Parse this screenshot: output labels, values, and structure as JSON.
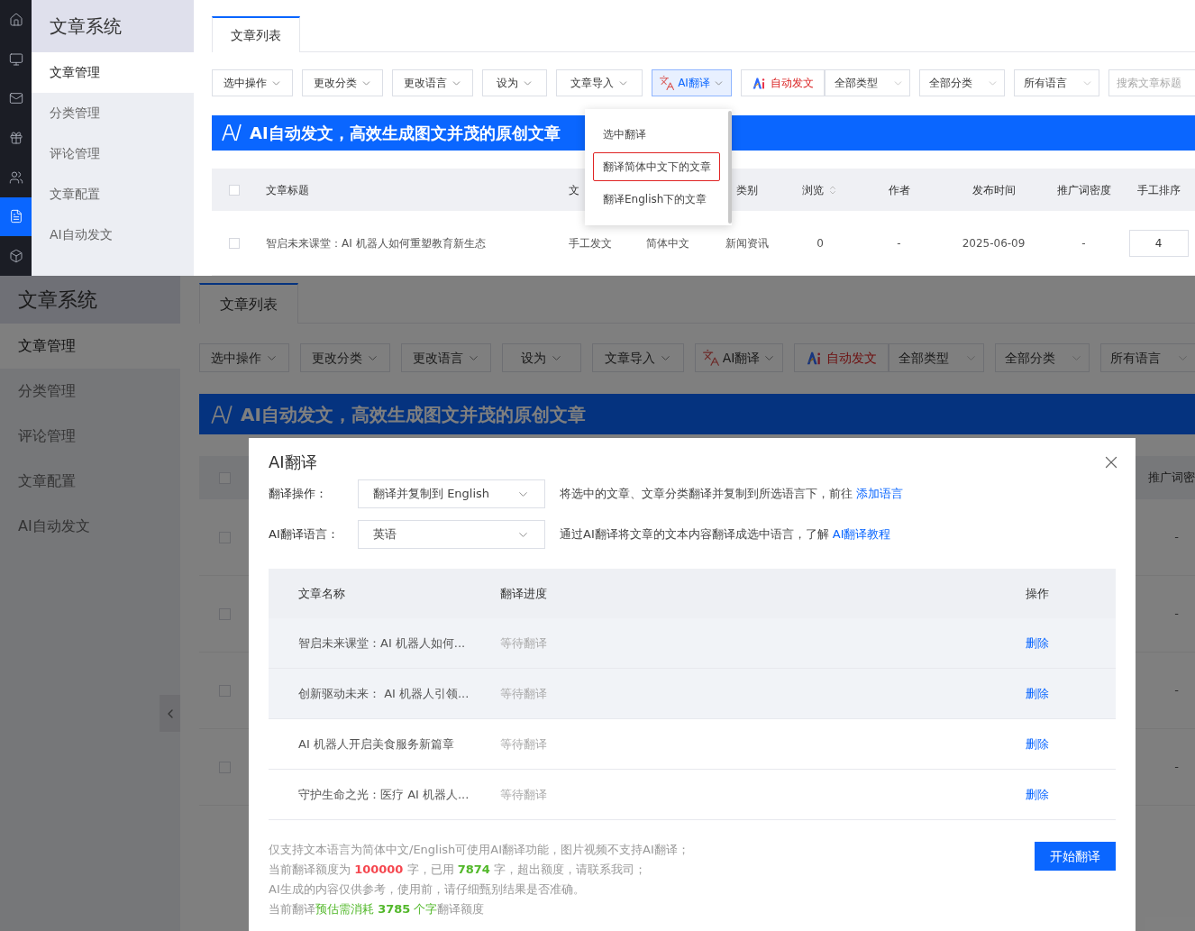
{
  "top": {
    "nav_icons": [
      {
        "selected": false
      },
      {
        "selected": false
      },
      {
        "selected": false
      },
      {
        "selected": false
      },
      {
        "selected": false
      },
      {
        "selected": true
      },
      {
        "selected": false
      }
    ],
    "sidebar": {
      "title": "文章系统",
      "items": [
        {
          "label": "文章管理",
          "selected": true
        },
        {
          "label": "分类管理",
          "selected": false
        },
        {
          "label": "评论管理",
          "selected": false
        },
        {
          "label": "文章配置",
          "selected": false
        },
        {
          "label": "AI自动发文",
          "selected": false
        }
      ]
    },
    "tabs": [
      {
        "label": "文章列表",
        "selected": true
      }
    ],
    "toolbar": [
      {
        "kind": "menu",
        "label": "选中操作"
      },
      {
        "kind": "menu",
        "label": "更改分类"
      },
      {
        "kind": "menu",
        "label": "更改语言"
      },
      {
        "kind": "menu",
        "label": "设为"
      },
      {
        "kind": "menu",
        "label": "文章导入"
      },
      {
        "kind": "translate",
        "label": "AI翻译",
        "expanded": true
      },
      {
        "kind": "autopost",
        "label": "自动发文"
      },
      {
        "kind": "select",
        "label": "全部类型"
      },
      {
        "kind": "select",
        "label": "全部分类"
      },
      {
        "kind": "select",
        "label": "所有语言"
      },
      {
        "kind": "search",
        "placeholder": "搜索文章标题"
      }
    ],
    "banner": "AI自动发文，高效生成图文并茂的原创文章",
    "table": {
      "header_checked": false,
      "columns": [
        {
          "label": "文章标题"
        },
        {
          "label": "文"
        },
        {},
        {
          "label": "类别"
        },
        {
          "label": "浏览",
          "sortable": true
        },
        {
          "label": "作者"
        },
        {
          "label": "发布时间"
        },
        {
          "label": "推广词密度"
        },
        {
          "label": "手工排序"
        }
      ],
      "rows": [
        {
          "checked": false,
          "cells": [
            "智启未来课堂：AI 机器人如何重塑教育新生态",
            "手工发文",
            "简体中文",
            "新闻资讯",
            "0",
            "-",
            "2025-06-09",
            "-"
          ],
          "order": "4"
        }
      ]
    },
    "dropdown": {
      "items": [
        {
          "label": "选中翻译",
          "selected": false
        },
        {
          "label": "翻译简体中文下的文章",
          "selected": true
        },
        {
          "label": "翻译English下的文章",
          "selected": false
        }
      ]
    }
  },
  "bottom": {
    "sidebar": {
      "title": "文章系统",
      "items": [
        {
          "label": "文章管理",
          "selected": true
        },
        {
          "label": "分类管理",
          "selected": false
        },
        {
          "label": "评论管理",
          "selected": false
        },
        {
          "label": "文章配置",
          "selected": false
        },
        {
          "label": "AI自动发文",
          "selected": false
        }
      ]
    },
    "tabs": [
      {
        "label": "文章列表",
        "selected": true
      }
    ],
    "toolbar": [
      {
        "kind": "menu",
        "label": "选中操作"
      },
      {
        "kind": "menu",
        "label": "更改分类"
      },
      {
        "kind": "menu",
        "label": "更改语言"
      },
      {
        "kind": "menu",
        "label": "设为"
      },
      {
        "kind": "menu",
        "label": "文章导入"
      },
      {
        "kind": "translate",
        "label": "AI翻译",
        "expanded": false
      },
      {
        "kind": "autopost",
        "label": "自动发文"
      },
      {
        "kind": "select",
        "label": "全部类型"
      },
      {
        "kind": "select",
        "label": "全部分类"
      },
      {
        "kind": "select",
        "label": "所有语言"
      }
    ],
    "banner": "AI自动发文，高效生成图文并茂的原创文章",
    "back_table": {
      "header_checked": false,
      "column": "推广词密",
      "rows": [
        {
          "checked": false,
          "value": "-"
        },
        {
          "checked": false,
          "value": "-"
        },
        {
          "checked": false,
          "value": "-"
        },
        {
          "checked": false,
          "value": "-"
        }
      ]
    },
    "modal": {
      "title": "AI翻译",
      "fields": [
        {
          "label": "翻译操作：",
          "value": "翻译并复制到 English",
          "note": "将选中的文章、文章分类翻译并复制到所选语言下，前往",
          "link": "添加语言"
        },
        {
          "label": "AI翻译语言：",
          "value": "英语",
          "note": "通过AI翻译将文章的文本内容翻译成选中语言，了解",
          "link": "AI翻译教程"
        }
      ],
      "table": {
        "columns": [
          "文章名称",
          "翻译进度",
          "操作"
        ],
        "rows": [
          {
            "title": "智启未来课堂：AI 机器人如何...",
            "status": "等待翻译",
            "action": "删除",
            "shaded": true
          },
          {
            "title": "创新驱动未来： AI 机器人引领...",
            "status": "等待翻译",
            "action": "删除",
            "shaded": true
          },
          {
            "title": "AI 机器人开启美食服务新篇章",
            "status": "等待翻译",
            "action": "删除",
            "shaded": false
          },
          {
            "title": "守护生命之光：医疗 AI 机器人...",
            "status": "等待翻译",
            "action": "删除",
            "shaded": false
          }
        ]
      },
      "notes": [
        [
          {
            "text": "仅支持文本语言为简体中文/English可使用AI翻译功能，图片视频不支持AI翻译；"
          }
        ],
        [
          {
            "text": "当前翻译额度为 "
          },
          {
            "text": "**100000**",
            "color": "#f5474f"
          },
          {
            "text": " 字，已用 "
          },
          {
            "text": "**7874**",
            "color": "#52b82a"
          },
          {
            "text": " 字，超出额度，请联系我司；"
          }
        ],
        [
          {
            "text": "AI生成的内容仅供参考，使用前，请仔细甄别结果是否准确。"
          }
        ],
        [
          {
            "text": "当前翻译"
          },
          {
            "text": "预估需消耗 **3785** 个字",
            "color": "#52b82a"
          },
          {
            "text": "翻译额度"
          }
        ]
      ],
      "button": "开始翻译"
    }
  }
}
